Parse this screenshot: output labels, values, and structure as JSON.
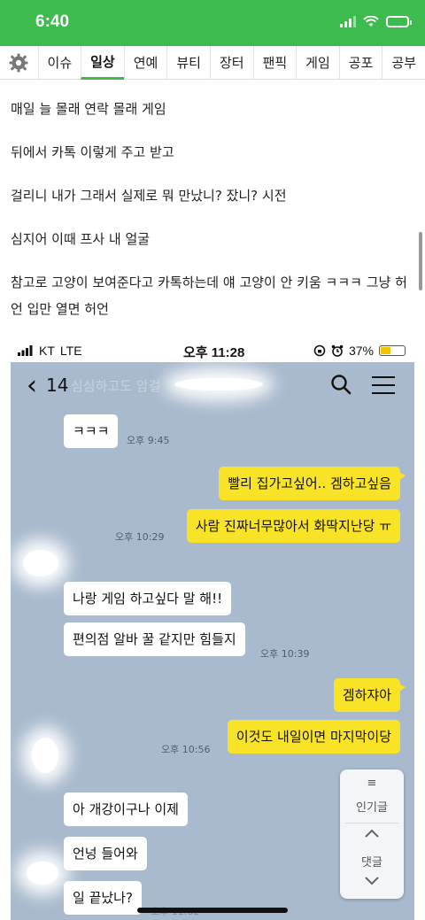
{
  "status": {
    "time": "6:40"
  },
  "tabs": [
    {
      "label": "이슈",
      "active": false
    },
    {
      "label": "일상",
      "active": true
    },
    {
      "label": "연예",
      "active": false
    },
    {
      "label": "뷰티",
      "active": false
    },
    {
      "label": "장터",
      "active": false
    },
    {
      "label": "팬픽",
      "active": false
    },
    {
      "label": "게임",
      "active": false
    },
    {
      "label": "공포",
      "active": false
    },
    {
      "label": "공부",
      "active": false
    }
  ],
  "article": {
    "paragraphs": [
      "매일 늘 몰래 연락 몰래 게임",
      "뒤에서 카톡 이렇게 주고 받고",
      "걸리니 내가 그래서 실제로 뭐 만났니? 잤니? 시전",
      "심지어 이때 프사 내 얼굴",
      "참고로 고양이 보여준다고 카톡하는데 얘 고양이 안 키움 ㅋㅋㅋ 그냥 허언 입만 열면 허언"
    ]
  },
  "screenshot": {
    "status": {
      "carrier": "KT",
      "network": "LTE",
      "time": "오후 11:28",
      "battery": "37%"
    },
    "header": {
      "count": "14",
      "title_blurred": "심심하고도 암걸"
    },
    "messages": [
      {
        "side": "in",
        "text": "ㅋㅋㅋ",
        "time": "오후 9:45"
      },
      {
        "side": "out",
        "text": "빨리 집가고싶어.. 겜하고싶음",
        "time": ""
      },
      {
        "side": "out",
        "text": "사람 진짜너무많아서 화딱지난당 ㅠ",
        "time": "오후 10:29"
      },
      {
        "side": "in",
        "text": "나랑 게임 하고싶다 말 해!!",
        "time": ""
      },
      {
        "side": "in",
        "text": "편의점 알바 꿀 같지만 힘들지",
        "time": "오후 10:39"
      },
      {
        "side": "out",
        "text": "겜하쟈아",
        "time": ""
      },
      {
        "side": "out",
        "text": "이것도 내일이면 마지막이당",
        "time": "오후 10:56"
      },
      {
        "side": "in",
        "text": "아 개강이구나 이제",
        "time": ""
      },
      {
        "side": "in",
        "text": "언넝 들어와",
        "time": ""
      },
      {
        "side": "in",
        "text": "일 끝났나?",
        "time": "오후 11:02"
      }
    ]
  },
  "floating_panel": {
    "popular_label": "인기글",
    "comments_label": "댓글"
  }
}
